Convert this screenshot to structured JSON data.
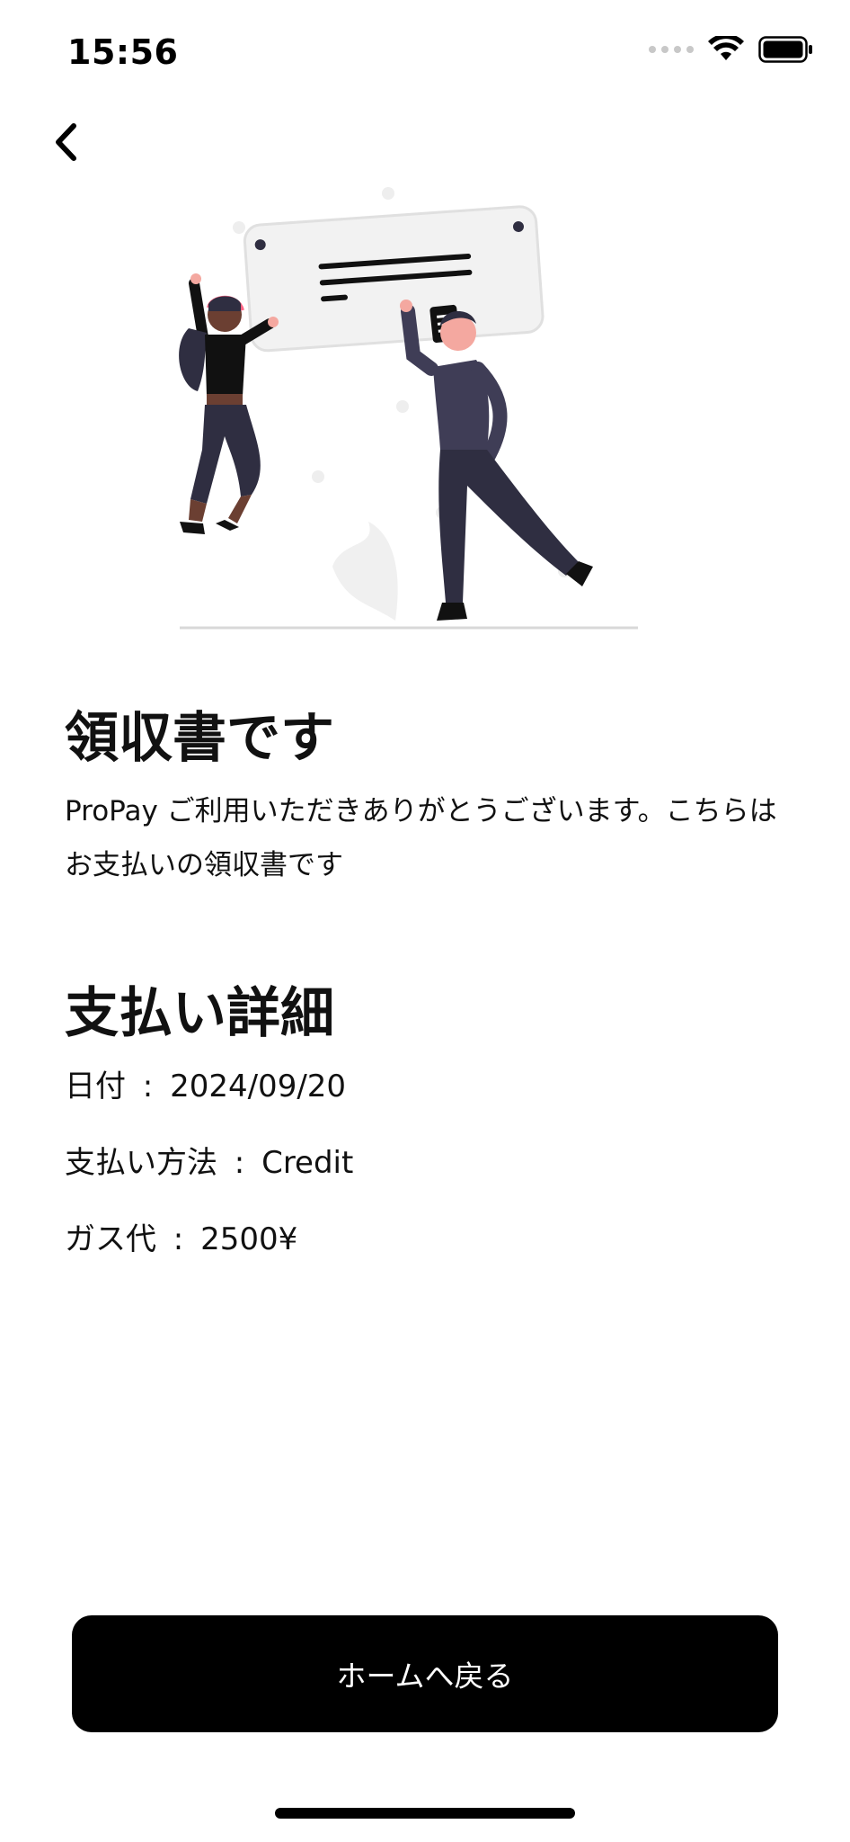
{
  "status_bar": {
    "time": "15:56",
    "icons": [
      "signal-dots-icon",
      "wifi-icon",
      "battery-icon"
    ]
  },
  "nav": {
    "back_icon": "chevron-left-icon"
  },
  "illustration": {
    "description_icon": "receipt-celebration-illustration",
    "colors": {
      "figure_dark": "#2f2e41",
      "skin": "#f4a8a0",
      "board": "#f2f2f2",
      "accent_pink": "#ff6584"
    }
  },
  "receipt": {
    "title": "領収書です",
    "message": "ProPay ご利用いただきありがとうございます。こちらはお支払いの領収書です"
  },
  "details": {
    "title": "支払い詳細",
    "rows": [
      {
        "label": "日付",
        "value": "2024/09/20"
      },
      {
        "label": "支払い方法",
        "value": "Credit"
      },
      {
        "label": "ガス代",
        "value": "2500¥"
      }
    ]
  },
  "actions": {
    "home_button_label": "ホームへ戻る"
  },
  "colors": {
    "button_bg": "#000000",
    "button_text": "#ffffff",
    "background": "#ffffff"
  }
}
